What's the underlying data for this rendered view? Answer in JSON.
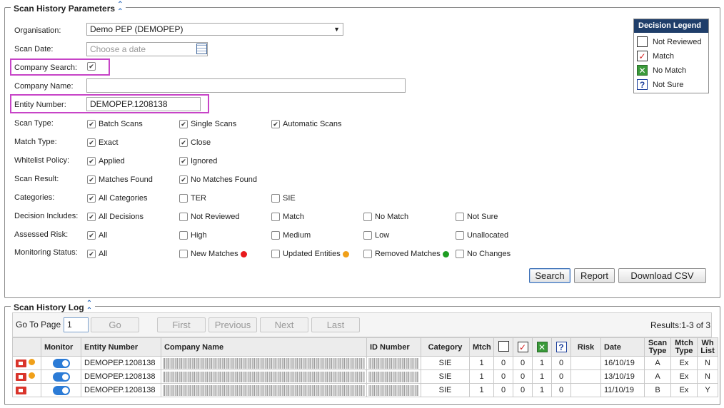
{
  "params": {
    "title": "Scan History Parameters",
    "organisation_label": "Organisation:",
    "organisation_value": "Demo PEP (DEMOPEP)",
    "scan_date_label": "Scan Date:",
    "scan_date_placeholder": "Choose a date",
    "company_search_label": "Company Search:",
    "company_name_label": "Company Name:",
    "entity_number_label": "Entity Number:",
    "entity_number_value": "DEMOPEP.1208138",
    "scan_type_label": "Scan Type:",
    "scan_type_options": [
      "Batch Scans",
      "Single Scans",
      "Automatic Scans"
    ],
    "match_type_label": "Match Type:",
    "match_type_options": [
      "Exact",
      "Close"
    ],
    "whitelist_label": "Whitelist Policy:",
    "whitelist_options": [
      "Applied",
      "Ignored"
    ],
    "scan_result_label": "Scan Result:",
    "scan_result_options": [
      "Matches Found",
      "No Matches Found"
    ],
    "categories_label": "Categories:",
    "categories_options": [
      "All Categories",
      "TER",
      "SIE"
    ],
    "decision_label": "Decision Includes:",
    "decision_options": [
      "All Decisions",
      "Not Reviewed",
      "Match",
      "No Match",
      "Not Sure"
    ],
    "risk_label": "Assessed Risk:",
    "risk_options": [
      "All",
      "High",
      "Medium",
      "Low",
      "Unallocated"
    ],
    "monitoring_label": "Monitoring Status:",
    "monitoring_options": [
      "All",
      "New Matches",
      "Updated Entities",
      "Removed Matches",
      "No Changes"
    ],
    "buttons": {
      "search": "Search",
      "report": "Report",
      "download": "Download CSV"
    }
  },
  "decision_legend": {
    "title": "Decision Legend",
    "items": [
      "Not Reviewed",
      "Match",
      "No Match",
      "Not Sure"
    ]
  },
  "log": {
    "title": "Scan History Log",
    "goto_label": "Go To Page",
    "goto_value": "1",
    "go": "Go",
    "first": "First",
    "previous": "Previous",
    "next": "Next",
    "last": "Last",
    "results": "Results:1-3 of 3",
    "headers": {
      "monitor": "Monitor",
      "entity": "Entity Number",
      "company": "Company Name",
      "id": "ID Number",
      "category": "Category",
      "mtch": "Mtch",
      "risk": "Risk",
      "date": "Date",
      "scan_type": "Scan Type",
      "mtch_type": "Mtch Type",
      "wh_list": "Wh List"
    },
    "rows": [
      {
        "entity": "DEMOPEP.1208138",
        "category": "SIE",
        "mtch": "1",
        "nr": "0",
        "m": "0",
        "nm": "1",
        "ns": "0",
        "date": "16/10/19",
        "scan_type": "A",
        "mtch_type": "Ex",
        "wh": "N"
      },
      {
        "entity": "DEMOPEP.1208138",
        "category": "SIE",
        "mtch": "1",
        "nr": "0",
        "m": "0",
        "nm": "1",
        "ns": "0",
        "date": "13/10/19",
        "scan_type": "A",
        "mtch_type": "Ex",
        "wh": "N"
      },
      {
        "entity": "DEMOPEP.1208138",
        "category": "SIE",
        "mtch": "1",
        "nr": "0",
        "m": "0",
        "nm": "1",
        "ns": "0",
        "date": "11/10/19",
        "scan_type": "B",
        "mtch_type": "Ex",
        "wh": "Y"
      }
    ]
  },
  "colors": {
    "new_matches": "#e8191c",
    "updated_entities": "#f0a01a",
    "removed_matches": "#1e9d22",
    "highlight": "#c744c7",
    "legend_header": "#1f3e6a"
  }
}
